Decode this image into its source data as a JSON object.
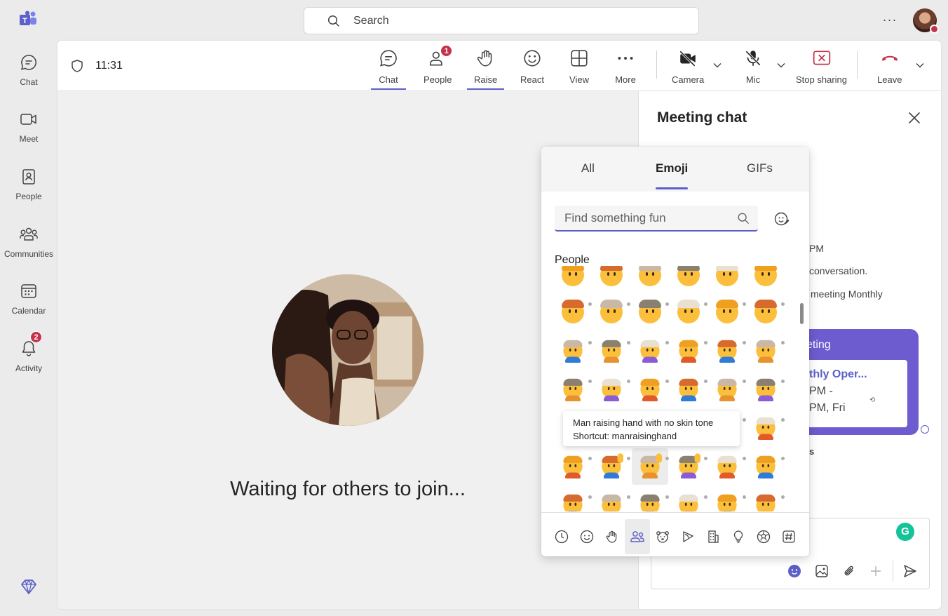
{
  "search": {
    "placeholder": "Search"
  },
  "rail": {
    "items": [
      {
        "label": "Chat"
      },
      {
        "label": "Meet"
      },
      {
        "label": "People"
      },
      {
        "label": "Communities"
      },
      {
        "label": "Calendar"
      },
      {
        "label": "Activity",
        "badge": "2"
      }
    ]
  },
  "meeting": {
    "time": "11:31",
    "toolbar": {
      "chat": "Chat",
      "people": "People",
      "people_badge": "1",
      "raise": "Raise",
      "react": "React",
      "view": "View",
      "more": "More",
      "camera": "Camera",
      "mic": "Mic",
      "stop_sharing": "Stop sharing",
      "leave": "Leave"
    },
    "waiting_text": "Waiting for others to join..."
  },
  "chat": {
    "title": "Meeting chat",
    "lines": [
      "PM",
      "conversation.",
      "meeting Monthly"
    ],
    "card": {
      "header": "eting",
      "title": "thly Oper...",
      "line1": "PM -",
      "line2": "PM, Fri"
    },
    "bold_fragment": "s"
  },
  "picker": {
    "tabs": {
      "all": "All",
      "emoji": "Emoji",
      "gifs": "GIFs"
    },
    "search_placeholder": "Find something fun",
    "section": "People",
    "tooltip": {
      "line1": "Man raising hand with no skin tone",
      "line2": "Shortcut: manraisinghand"
    }
  },
  "colors": {
    "brand": "#5b5fc7",
    "badge": "#c4314b",
    "leave": "#c4314b",
    "card": "#6c5ccf"
  }
}
